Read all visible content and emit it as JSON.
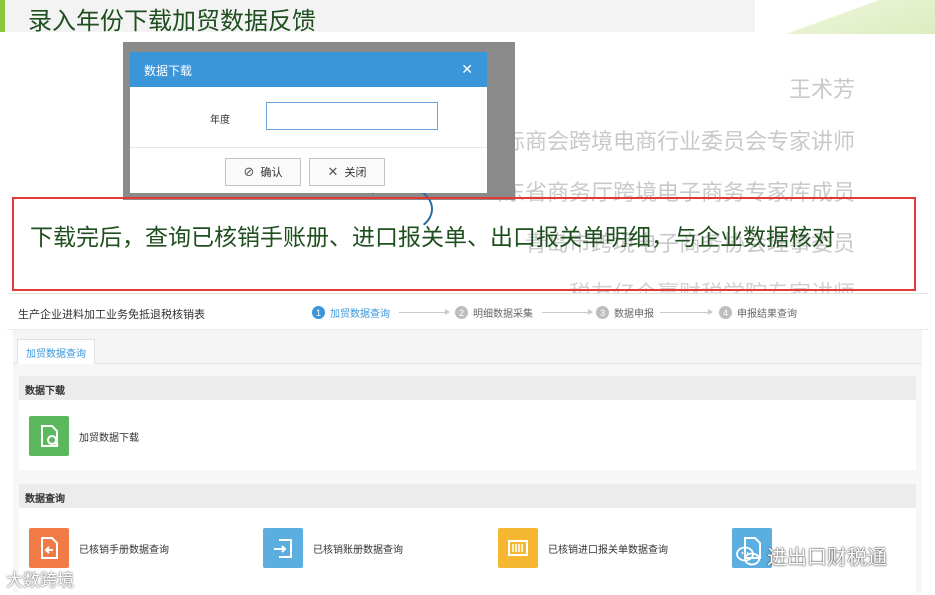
{
  "slide": {
    "title": "录入年份下载加贸数据反馈",
    "subtitle": "下载完后，查询已核销手账册、进口报关单、出口报关单明细，与企业数据核对",
    "watermark": {
      "name": "王术芳",
      "line1": "国国际商会跨境电商行业委员会专家讲师",
      "line2": "山东省商务厅跨境电子商务专家库成员",
      "line3": "青岛市跨境电子商务协会理事委员",
      "line4": "税友亿企赢财税学院专家讲师"
    },
    "colors": {
      "title_text": "#1f4e1f",
      "accent": "#8cc63f",
      "dialog_header": "#3b96d9",
      "highlight_box": "#e53935"
    }
  },
  "dialog": {
    "title": "数据下载",
    "close_icon": "close-icon",
    "field_label": "年度",
    "field_value": "",
    "confirm_label": "确认",
    "close_label": "关闭"
  },
  "app": {
    "title": "生产企业进料加工业务免抵退税核销表",
    "steps": [
      {
        "num": "1",
        "label": "加贸数据查询",
        "active": true
      },
      {
        "num": "2",
        "label": "明细数据采集",
        "active": false
      },
      {
        "num": "3",
        "label": "数据申报",
        "active": false
      },
      {
        "num": "4",
        "label": "申报结果查询",
        "active": false
      }
    ],
    "tab": "加贸数据查询",
    "download_section": {
      "header": "数据下载",
      "items": [
        {
          "label": "加贸数据下载",
          "icon": "document-download-icon",
          "color": "#5cb85c"
        }
      ]
    },
    "query_section": {
      "header": "数据查询",
      "items": [
        {
          "label": "已核销手册数据查询",
          "icon": "document-back-icon",
          "color": "#f07b47"
        },
        {
          "label": "已核销账册数据查询",
          "icon": "document-import-icon",
          "color": "#5aaee0"
        },
        {
          "label": "已核销进口报关单数据查询",
          "icon": "barcode-icon",
          "color": "#f5b731"
        },
        {
          "label": "",
          "icon": "document-icon",
          "color": "#5aaee0"
        }
      ]
    }
  },
  "branding": {
    "left": "大数跨境",
    "right": "进出口财税通"
  }
}
